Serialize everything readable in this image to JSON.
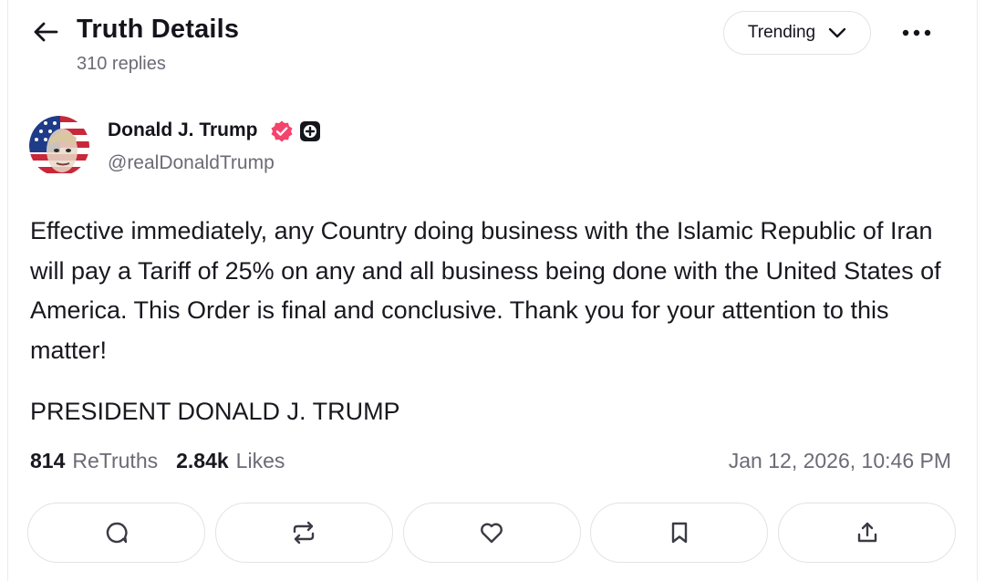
{
  "header": {
    "title": "Truth Details",
    "replies": "310 replies",
    "sort_label": "Trending",
    "back_icon": "arrow-left-icon",
    "more_icon": "more-horizontal-icon"
  },
  "author": {
    "name": "Donald J. Trump",
    "handle": "@realDonaldTrump",
    "verified_icon": "verified-badge-icon",
    "badge_icon": "plus-badge-icon",
    "verified_color": "#f4436c"
  },
  "post": {
    "text": "Effective immediately, any Country doing business with the Islamic Republic of Iran will pay a Tariff of 25% on any and all business being done with the United States of America. This Order is final and conclusive. Thank you for your attention to this matter!",
    "signature": "PRESIDENT DONALD J. TRUMP"
  },
  "stats": {
    "retruths_count": "814",
    "retruths_label": "ReTruths",
    "likes_count": "2.84k",
    "likes_label": "Likes",
    "timestamp": "Jan 12, 2026, 10:46 PM"
  },
  "actions": [
    {
      "icon": "reply-icon"
    },
    {
      "icon": "retruth-icon"
    },
    {
      "icon": "heart-icon"
    },
    {
      "icon": "bookmark-icon"
    },
    {
      "icon": "share-icon"
    }
  ]
}
